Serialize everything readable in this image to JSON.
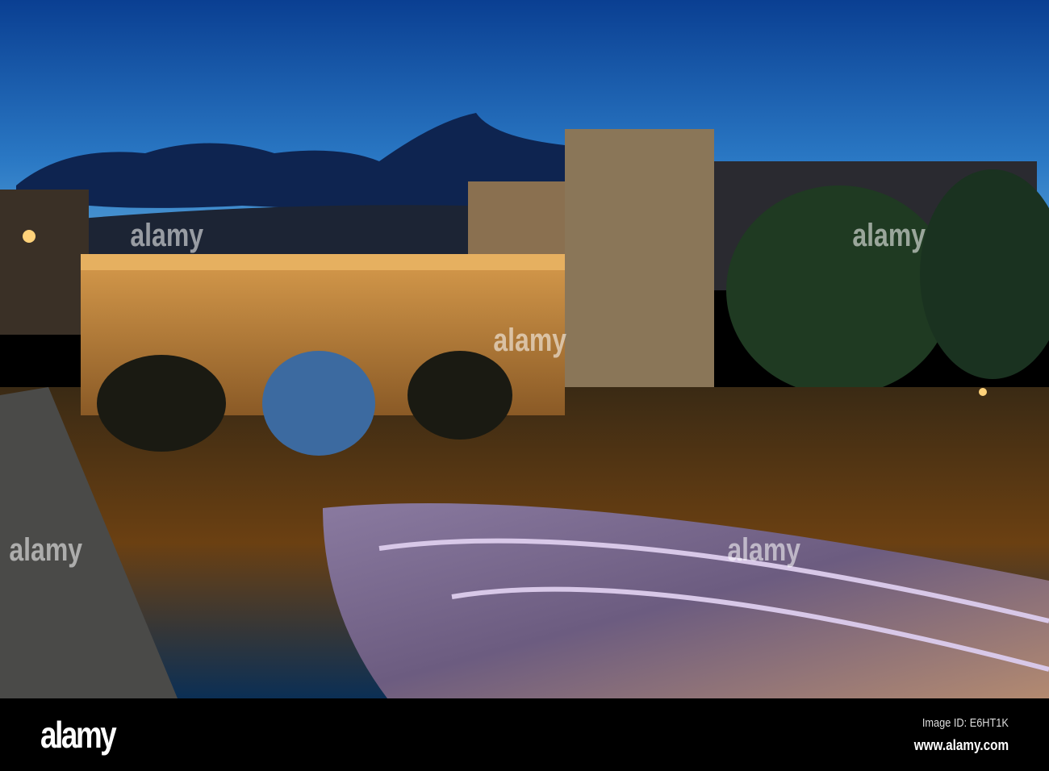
{
  "footer": {
    "logo": "alamy",
    "image_id": "Image ID: E6HT1K",
    "url": "www.alamy.com"
  },
  "watermark": "alamy",
  "colors": {
    "sky_top": "#0b4aa0",
    "sky_bottom": "#3f8fd0",
    "stone_lit": "#c98a3a",
    "water": "#0b2a44"
  }
}
